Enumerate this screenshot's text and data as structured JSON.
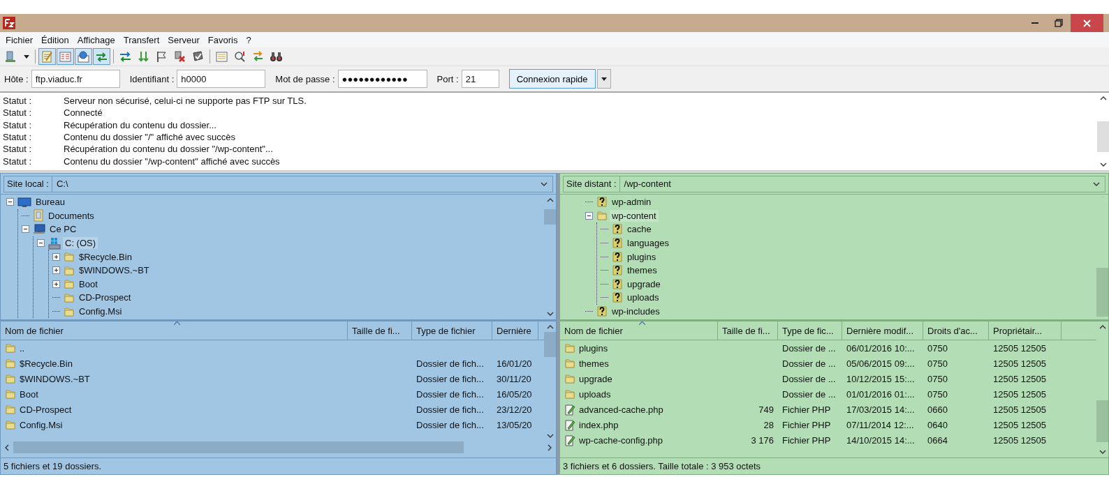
{
  "menu": [
    "Fichier",
    "Édition",
    "Affichage",
    "Transfert",
    "Serveur",
    "Favoris",
    "?"
  ],
  "toolbar": [
    {
      "kind": "site-manager",
      "pressed": false
    },
    {
      "kind": "dropdown",
      "pressed": false
    },
    {
      "kind": "separator"
    },
    {
      "kind": "log",
      "pressed": true
    },
    {
      "kind": "tree-local",
      "pressed": true
    },
    {
      "kind": "tree-remote",
      "pressed": true
    },
    {
      "kind": "queue",
      "pressed": true
    },
    {
      "kind": "separator"
    },
    {
      "kind": "refresh",
      "pressed": false
    },
    {
      "kind": "process-queue",
      "pressed": false
    },
    {
      "kind": "cancel",
      "pressed": false
    },
    {
      "kind": "disconnect",
      "pressed": false
    },
    {
      "kind": "reconnect",
      "pressed": false
    },
    {
      "kind": "separator"
    },
    {
      "kind": "filter",
      "pressed": false
    },
    {
      "kind": "compare",
      "pressed": false
    },
    {
      "kind": "sync",
      "pressed": false
    },
    {
      "kind": "search",
      "pressed": false
    }
  ],
  "quickconnect": {
    "fields": [
      {
        "label": "Hôte :",
        "value": "ftp.viaduc.fr"
      },
      {
        "label": "Identifiant :",
        "value": "h0000"
      },
      {
        "label": "Mot de passe :",
        "value": "●●●●●●●●●●●●"
      },
      {
        "label": "Port :",
        "value": "21"
      }
    ],
    "button": "Connexion rapide"
  },
  "log": [
    {
      "label": "Statut :",
      "message": "Serveur non sécurisé, celui-ci ne supporte pas FTP sur TLS."
    },
    {
      "label": "Statut :",
      "message": "Connecté"
    },
    {
      "label": "Statut :",
      "message": "Récupération du contenu du dossier..."
    },
    {
      "label": "Statut :",
      "message": "Contenu du dossier \"/\" affiché avec succès"
    },
    {
      "label": "Statut :",
      "message": "Récupération du contenu du dossier \"/wp-content\"..."
    },
    {
      "label": "Statut :",
      "message": "Contenu du dossier \"/wp-content\" affiché avec succès"
    }
  ],
  "local_site": {
    "label": "Site local :",
    "path": "C:\\",
    "tree": [
      {
        "label": "Bureau",
        "kind": "desktop",
        "selected": false,
        "expanded": true,
        "children": [
          {
            "label": "Documents",
            "kind": "documents",
            "selected": false
          },
          {
            "label": "Ce PC",
            "kind": "computer",
            "selected": false,
            "expanded": true,
            "children": [
              {
                "label": "C: (OS)",
                "kind": "drive",
                "selected": true,
                "expanded": true,
                "children": [
                  {
                    "label": "$Recycle.Bin",
                    "kind": "folder",
                    "selected": false,
                    "expanded": false
                  },
                  {
                    "label": "$WINDOWS.~BT",
                    "kind": "folder",
                    "selected": false,
                    "expanded": false
                  },
                  {
                    "label": "Boot",
                    "kind": "folder",
                    "selected": false,
                    "expanded": false
                  },
                  {
                    "label": "CD-Prospect",
                    "kind": "folder",
                    "selected": false
                  },
                  {
                    "label": "Config.Msi",
                    "kind": "folder",
                    "selected": false
                  }
                ]
              }
            ]
          }
        ]
      }
    ],
    "file_list": {
      "columns": [
        {
          "label": "Nom de fichier",
          "sorted": true
        },
        {
          "label": "Taille de fi...",
          "sorted": false
        },
        {
          "label": "Type de fichier",
          "sorted": false
        },
        {
          "label": "Dernière",
          "sorted": false
        }
      ],
      "rows": [
        {
          "kind": "folder",
          "name": ".."
        },
        {
          "kind": "folder",
          "name": "$Recycle.Bin",
          "type": "Dossier de fich...",
          "modified": "16/01/20"
        },
        {
          "kind": "folder",
          "name": "$WINDOWS.~BT",
          "type": "Dossier de fich...",
          "modified": "30/11/20"
        },
        {
          "kind": "folder",
          "name": "Boot",
          "type": "Dossier de fich...",
          "modified": "16/05/20"
        },
        {
          "kind": "folder",
          "name": "CD-Prospect",
          "type": "Dossier de fich...",
          "modified": "23/12/20"
        },
        {
          "kind": "folder",
          "name": "Config.Msi",
          "type": "Dossier de fich...",
          "modified": "13/05/20"
        }
      ]
    },
    "status": "5 fichiers et 19 dossiers."
  },
  "remote_site": {
    "label": "Site distant :",
    "path": "/wp-content",
    "tree": [
      {
        "label": "wp-admin",
        "kind": "unknown",
        "selected": false
      },
      {
        "label": "wp-content",
        "kind": "folder",
        "selected": true,
        "expanded": true,
        "children": [
          {
            "label": "cache",
            "kind": "unknown",
            "selected": false
          },
          {
            "label": "languages",
            "kind": "unknown",
            "selected": false
          },
          {
            "label": "plugins",
            "kind": "unknown",
            "selected": false
          },
          {
            "label": "themes",
            "kind": "unknown",
            "selected": false
          },
          {
            "label": "upgrade",
            "kind": "unknown",
            "selected": false
          },
          {
            "label": "uploads",
            "kind": "unknown",
            "selected": false
          }
        ]
      },
      {
        "label": "wp-includes",
        "kind": "unknown",
        "selected": false
      }
    ],
    "file_list": {
      "columns": [
        {
          "label": "Nom de fichier",
          "sorted": true
        },
        {
          "label": "Taille de fi...",
          "sorted": false
        },
        {
          "label": "Type de fic...",
          "sorted": false
        },
        {
          "label": "Dernière modif...",
          "sorted": false
        },
        {
          "label": "Droits d'ac...",
          "sorted": false
        },
        {
          "label": "Propriétair...",
          "sorted": false
        }
      ],
      "rows": [
        {
          "kind": "folder",
          "name": "plugins",
          "type": "Dossier de ...",
          "modified": "06/01/2016 10:...",
          "permissions": "0750",
          "owner": "12505 12505"
        },
        {
          "kind": "folder",
          "name": "themes",
          "type": "Dossier de ...",
          "modified": "05/06/2015 09:...",
          "permissions": "0750",
          "owner": "12505 12505"
        },
        {
          "kind": "folder",
          "name": "upgrade",
          "type": "Dossier de ...",
          "modified": "10/12/2015 15:...",
          "permissions": "0750",
          "owner": "12505 12505"
        },
        {
          "kind": "folder",
          "name": "uploads",
          "type": "Dossier de ...",
          "modified": "01/01/2016 01:...",
          "permissions": "0750",
          "owner": "12505 12505"
        },
        {
          "kind": "php",
          "name": "advanced-cache.php",
          "size": "749",
          "type": "Fichier PHP",
          "modified": "17/03/2015 14:...",
          "permissions": "0660",
          "owner": "12505 12505"
        },
        {
          "kind": "php",
          "name": "index.php",
          "size": "28",
          "type": "Fichier PHP",
          "modified": "07/11/2014 12:...",
          "permissions": "0640",
          "owner": "12505 12505"
        },
        {
          "kind": "php",
          "name": "wp-cache-config.php",
          "size": "3 176",
          "type": "Fichier PHP",
          "modified": "14/10/2015 14:...",
          "permissions": "0664",
          "owner": "12505 12505"
        }
      ]
    },
    "status": "3 fichiers et 6 dossiers. Taille totale : 3 953 octets"
  }
}
